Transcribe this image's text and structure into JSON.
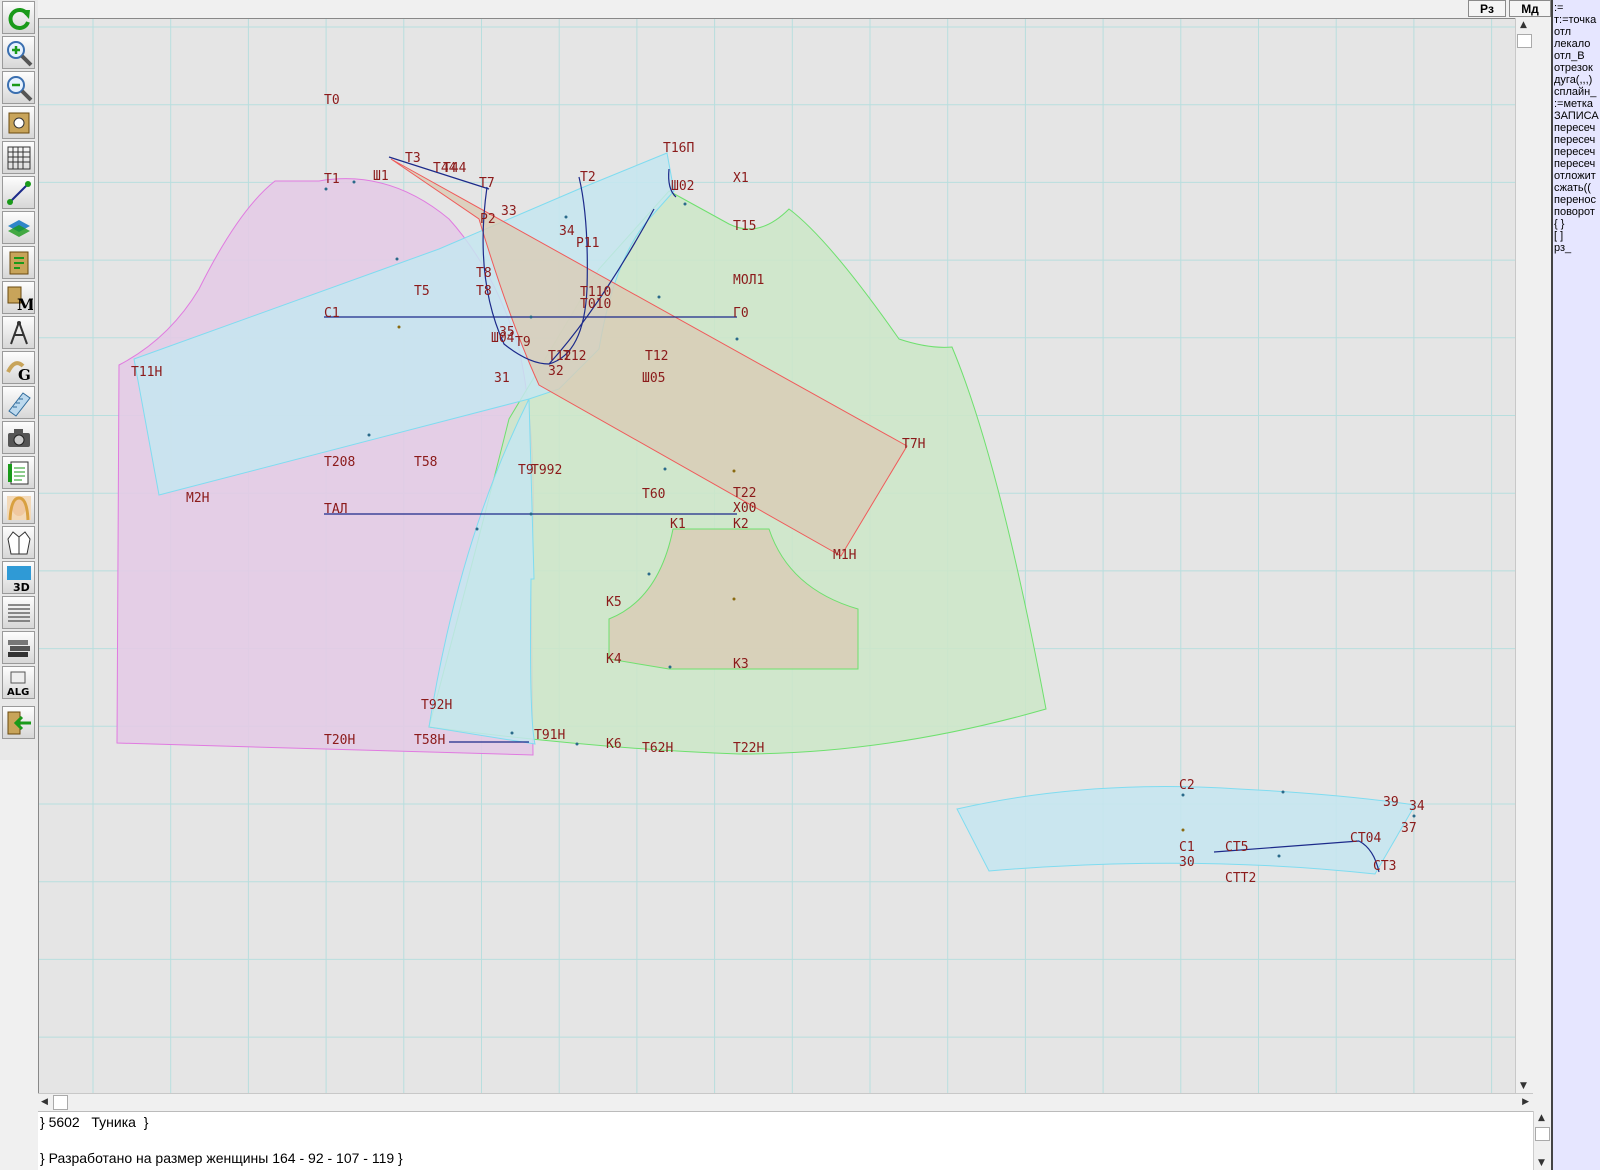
{
  "toolbar": [
    {
      "icon": "refresh-icon"
    },
    {
      "icon": "zoom-in-icon"
    },
    {
      "icon": "zoom-out-icon"
    },
    {
      "icon": "pattern-view-icon"
    },
    {
      "icon": "grid-icon"
    },
    {
      "icon": "line-tool-icon"
    },
    {
      "icon": "layer-icon"
    },
    {
      "icon": "piece-icon"
    },
    {
      "icon": "m-tool-icon"
    },
    {
      "icon": "compass-icon"
    },
    {
      "icon": "g-tool-icon"
    },
    {
      "icon": "sheet-icon"
    },
    {
      "icon": "camera-icon"
    },
    {
      "icon": "notepad-icon"
    },
    {
      "icon": "model-photo-icon"
    },
    {
      "icon": "garment-icon"
    },
    {
      "icon": "3d-icon"
    },
    {
      "icon": "lines-icon"
    },
    {
      "icon": "layers-stack-icon"
    },
    {
      "icon": "alg-icon"
    },
    {
      "icon": "exit-icon"
    }
  ],
  "top_buttons": {
    "rz": "Рз",
    "md": "Мд"
  },
  "functions": [
    ":=",
    "т:=точка",
    "отл",
    "лекало",
    "отл_В",
    "отрезок",
    "дуга(,,,)",
    "сплайн_",
    ":=метка",
    "ЗАПИСА",
    "пересеч",
    "пересеч",
    "пересеч",
    "пересеч",
    "отложит",
    "сжать((",
    "перенос",
    "поворот",
    "{ }",
    "[ ]",
    "рз_"
  ],
  "text_panel": {
    "line1": "} 5602   Туника  }",
    "line2": "} Разработано на размер женщины 164 - 92 - 107 - 119 }"
  },
  "labels": [
    "Т0",
    "Т1",
    "Ш1",
    "Т3",
    "Т44",
    "Т44",
    "Т7",
    "Р2",
    "33",
    "34",
    "Р11",
    "Т2",
    "Т16П",
    "Ш02",
    "Х1",
    "Т15",
    "Т8",
    "Т8",
    "Т5",
    "Т110",
    "Т010",
    "МОЛ1",
    "С1",
    "Г0",
    "Т11Н",
    "35",
    "Ш04",
    "Т9",
    "Т12",
    "Т12",
    "32",
    "31",
    "Т12",
    "Ш05",
    "Т7Н",
    "Т208",
    "Т58",
    "Т9",
    "Т992",
    "Т60",
    "Т22",
    "Х00",
    "М2Н",
    "ТАЛ",
    "К1",
    "К2",
    "М1Н",
    "К5",
    "К4",
    "К3",
    "Т92Н",
    "Т20Н",
    "Т58Н",
    "Т91Н",
    "К6",
    "Т62Н",
    "Т22Н",
    "С2",
    "39",
    "34",
    "37",
    "С1",
    "30",
    "СТ5",
    "СТ04",
    "СТ3",
    "СТТ2"
  ],
  "colors": {
    "sleeve_fill": "#e3cbe6",
    "sleeve_stroke": "#e07ae0",
    "blue_fill": "#c6e6f0",
    "blue_stroke": "#7fdcf0",
    "green_fill": "#cce8c8",
    "green_stroke": "#6ee06e",
    "rect_fill": "#d9ccb5",
    "rect_stroke": "#f05a5a",
    "grid": "#b8dede",
    "line": "#1c2a8a",
    "label": "#8b1a1a"
  }
}
